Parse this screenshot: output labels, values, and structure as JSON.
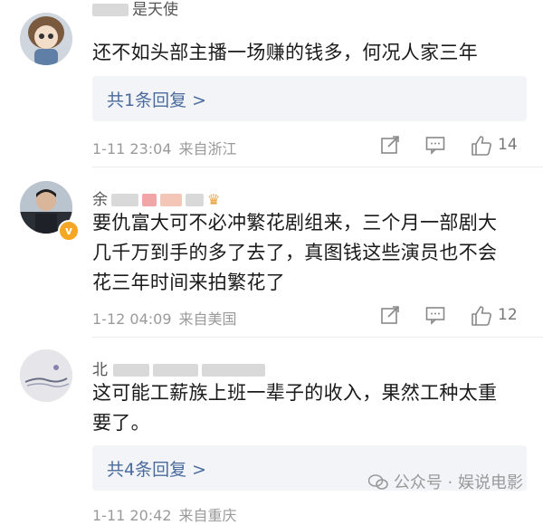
{
  "comments": [
    {
      "avatar": "doll-avatar",
      "nickname": "是天使",
      "text_lines": [
        "还不如头部主播一场赚的钱多，何况人家三年"
      ],
      "replies": "共1条回复 >",
      "time": "1-11 23:04",
      "source": "来自浙江",
      "likes": "14"
    },
    {
      "avatar": "man-avatar",
      "nickname": "余",
      "text_lines": [
        "要仇富大可不必冲繁花剧组来，三个月一部剧大",
        "几千万到手的多了去了，真图钱这些演员也不会",
        "花三年时间来拍繁花了"
      ],
      "time": "1-12 04:09",
      "source": "来自美国",
      "likes": "12"
    },
    {
      "avatar": "landscape-avatar",
      "nickname": "北",
      "text_lines": [
        "这可能工薪族上班一辈子的收入，果然工种太重",
        "要了。"
      ],
      "replies": "共4条回复 >",
      "time": "1-11 20:42",
      "source": "来自重庆"
    }
  ],
  "watermark": "公众号 · 娱说电影",
  "colors": {
    "link": "#4a6b9c",
    "meta": "#9a9a9a",
    "reply_bg": "#f2f4f7",
    "badge": "#f5a623"
  }
}
